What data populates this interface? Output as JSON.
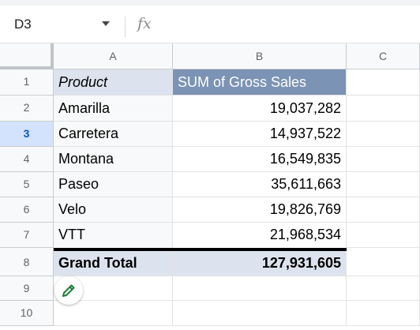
{
  "formula_bar": {
    "name_box": "D3",
    "fx_label": "fx",
    "formula": ""
  },
  "columns": [
    "A",
    "B",
    "C"
  ],
  "rows": [
    "1",
    "2",
    "3",
    "4",
    "5",
    "6",
    "7",
    "8",
    "9",
    "10"
  ],
  "active_row": "3",
  "pivot": {
    "header": {
      "product": "Product",
      "value": "SUM of Gross Sales"
    },
    "items": [
      {
        "product": "Amarilla",
        "value": "19,037,282"
      },
      {
        "product": "Carretera",
        "value": "14,937,522"
      },
      {
        "product": "Montana",
        "value": "16,549,835"
      },
      {
        "product": "Paseo",
        "value": "35,611,663"
      },
      {
        "product": "Velo",
        "value": "19,826,769"
      },
      {
        "product": "VTT",
        "value": "21,968,534"
      }
    ],
    "total": {
      "product": "Grand Total",
      "value": "127,931,605"
    }
  },
  "icons": {
    "name_box_dropdown": "chevron-down-icon",
    "edit_pivot": "pencil-icon"
  },
  "colors": {
    "pivot_header_bg": "#7b93b4",
    "pivot_label_bg": "#dde3ee",
    "active_row_highlight": "#d3e3fd"
  }
}
